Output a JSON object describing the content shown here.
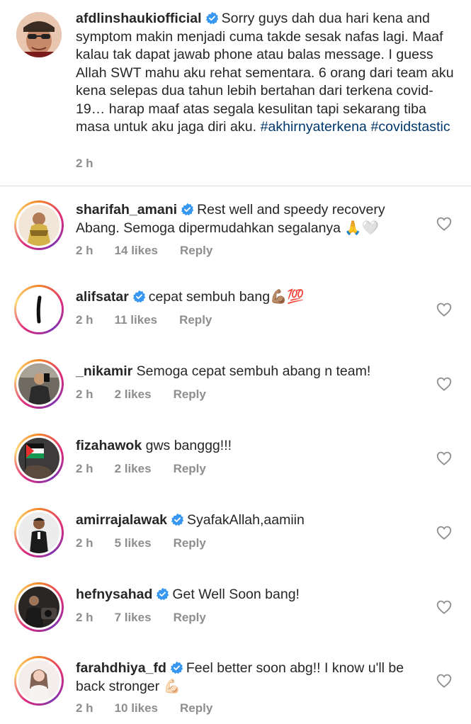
{
  "caption": {
    "username": "afdlinshaukiofficial",
    "text": "Sorry guys dah dua hari kena and symptom makin menjadi cuma takde sesak nafas lagi. Maaf kalau tak dapat jawab phone atau balas message. I guess Allah SWT mahu aku rehat sementara. 6 orang dari team aku kena selepas dua tahun lebih bertahan dari terkena covid-19…  harap maaf atas segala kesulitan tapi sekarang tiba masa untuk aku jaga diri aku. ",
    "hashtags": [
      "#akhirnyaterkena",
      "#covidstastic"
    ],
    "time": "2 h"
  },
  "comments": [
    {
      "username": "sharifah_amani",
      "verified": true,
      "text": "Rest well and speedy recovery Abang. Semoga dipermudahkan segalanya 🙏🤍",
      "time": "2 h",
      "likes": "14 likes",
      "reply": "Reply"
    },
    {
      "username": "alifsatar",
      "verified": true,
      "text": "cepat sembuh bang💪🏽💯",
      "time": "2 h",
      "likes": "11 likes",
      "reply": "Reply"
    },
    {
      "username": "_nikamir",
      "verified": false,
      "text": "Semoga cepat sembuh abang n team!",
      "time": "2 h",
      "likes": "2 likes",
      "reply": "Reply"
    },
    {
      "username": "fizahawok",
      "verified": false,
      "text": "gws banggg!!!",
      "time": "2 h",
      "likes": "2 likes",
      "reply": "Reply"
    },
    {
      "username": "amirrajalawak",
      "verified": true,
      "text": "SyafakAllah,aamiin",
      "time": "2 h",
      "likes": "5 likes",
      "reply": "Reply"
    },
    {
      "username": "hefnysahad",
      "verified": true,
      "text": "Get Well Soon bang!",
      "time": "2 h",
      "likes": "7 likes",
      "reply": "Reply"
    },
    {
      "username": "farahdhiya_fd",
      "verified": true,
      "text": "Feel better soon abg!! I know u'll be back stronger 💪🏻",
      "time": "2 h",
      "likes": "10 likes",
      "reply": "Reply"
    }
  ],
  "colors": {
    "text": "#262626",
    "meta": "#8e8e8e",
    "hashtag": "#00376b",
    "verified": "#3897f0",
    "divider": "#dbdbdb"
  },
  "icons": {
    "verified": "verified-badge-icon",
    "like": "heart-outline-icon"
  }
}
